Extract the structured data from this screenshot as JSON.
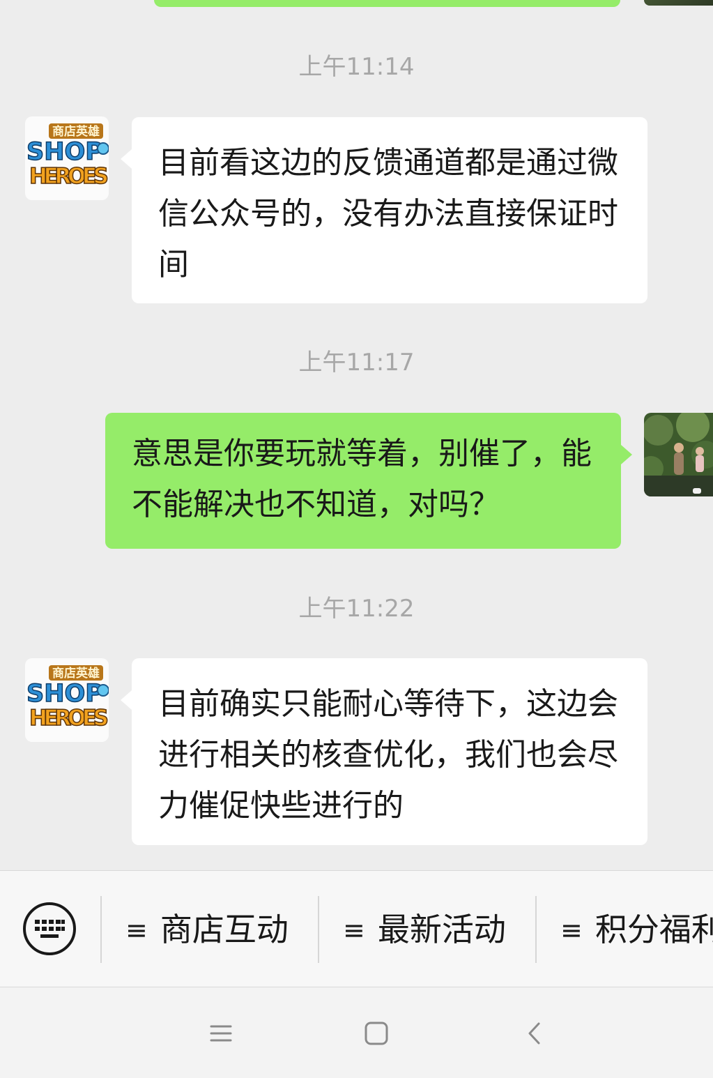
{
  "messages": [
    {
      "type": "time",
      "text": "上午11:14"
    },
    {
      "type": "incoming",
      "sender_avatar": "shop-heroes-avatar",
      "text": "目前看这边的反馈通道都是通过微信公众号的，没有办法直接保证时间"
    },
    {
      "type": "time",
      "text": "上午11:17"
    },
    {
      "type": "outgoing",
      "sender_avatar": "user-photo-avatar",
      "text": "意思是你要玩就等着，别催了，能不能解决也不知道，对吗？"
    },
    {
      "type": "time",
      "text": "上午11:22"
    },
    {
      "type": "incoming",
      "sender_avatar": "shop-heroes-avatar",
      "text": "目前确实只能耐心等待下，这边会进行相关的核查优化，我们也会尽力催促快些进行的"
    }
  ],
  "avatar": {
    "logo_top_text": "商店英雄",
    "logo_line1": "SHOP",
    "logo_line2": "HEROES"
  },
  "menu": {
    "keyboard_icon": "keyboard-icon",
    "items": [
      {
        "icon": "menu-lines-icon",
        "label": "商店互动"
      },
      {
        "icon": "menu-lines-icon",
        "label": "最新活动"
      },
      {
        "icon": "menu-lines-icon",
        "label": "积分福利"
      }
    ]
  },
  "navigation": {
    "buttons": [
      "recent-apps-icon",
      "home-icon",
      "back-icon"
    ]
  },
  "colors": {
    "background": "#ededed",
    "outgoing_bubble": "#95ec69",
    "incoming_bubble": "#ffffff",
    "timestamp": "#a7a7a7"
  }
}
